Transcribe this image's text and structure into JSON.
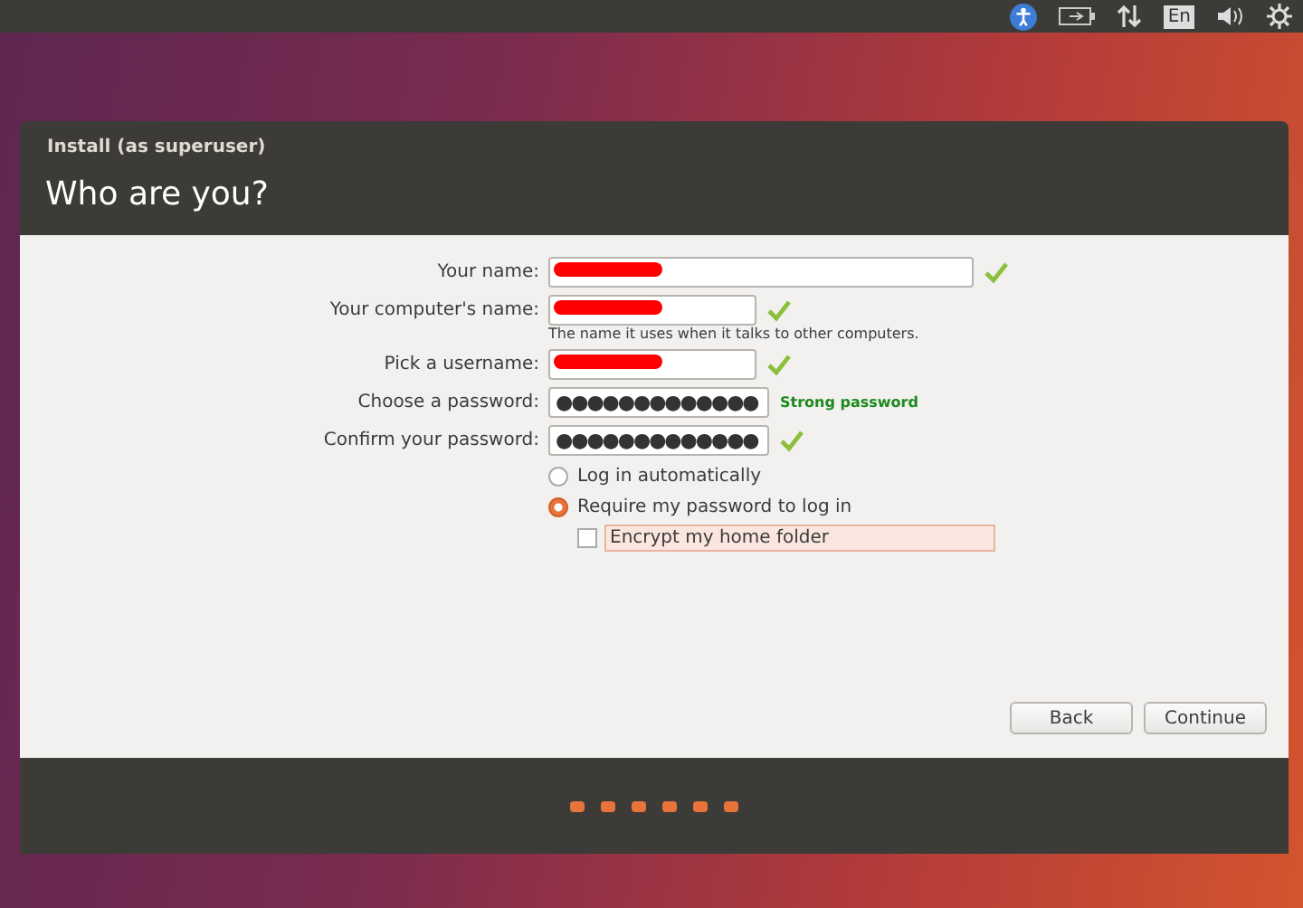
{
  "window": {
    "title": "Install (as superuser)",
    "heading": "Who are you?"
  },
  "top_bar": {
    "keyboard_layout": "En"
  },
  "fields": [
    {
      "kind": "text",
      "label": "Your name:",
      "redacted": true,
      "valid": true
    },
    {
      "kind": "text",
      "label": "Your computer's name:",
      "redacted": true,
      "valid": true,
      "hint": "The name it uses when it talks to other computers."
    },
    {
      "kind": "text",
      "label": "Pick a username:",
      "redacted": true,
      "valid": true
    },
    {
      "kind": "password",
      "label": "Choose a password:",
      "value": "●●●●●●●●●●●●●",
      "valid": false,
      "strength": "Strong password"
    },
    {
      "kind": "password",
      "label": "Confirm your password:",
      "value": "●●●●●●●●●●●●●",
      "valid": true
    }
  ],
  "login_options": [
    {
      "label": "Log in automatically",
      "selected": false
    },
    {
      "label": "Require my password to log in",
      "selected": true
    }
  ],
  "encrypt": {
    "label": "Encrypt my home folder",
    "checked": false,
    "focused": true
  },
  "buttons": [
    {
      "label": "Back"
    },
    {
      "label": "Continue"
    }
  ]
}
